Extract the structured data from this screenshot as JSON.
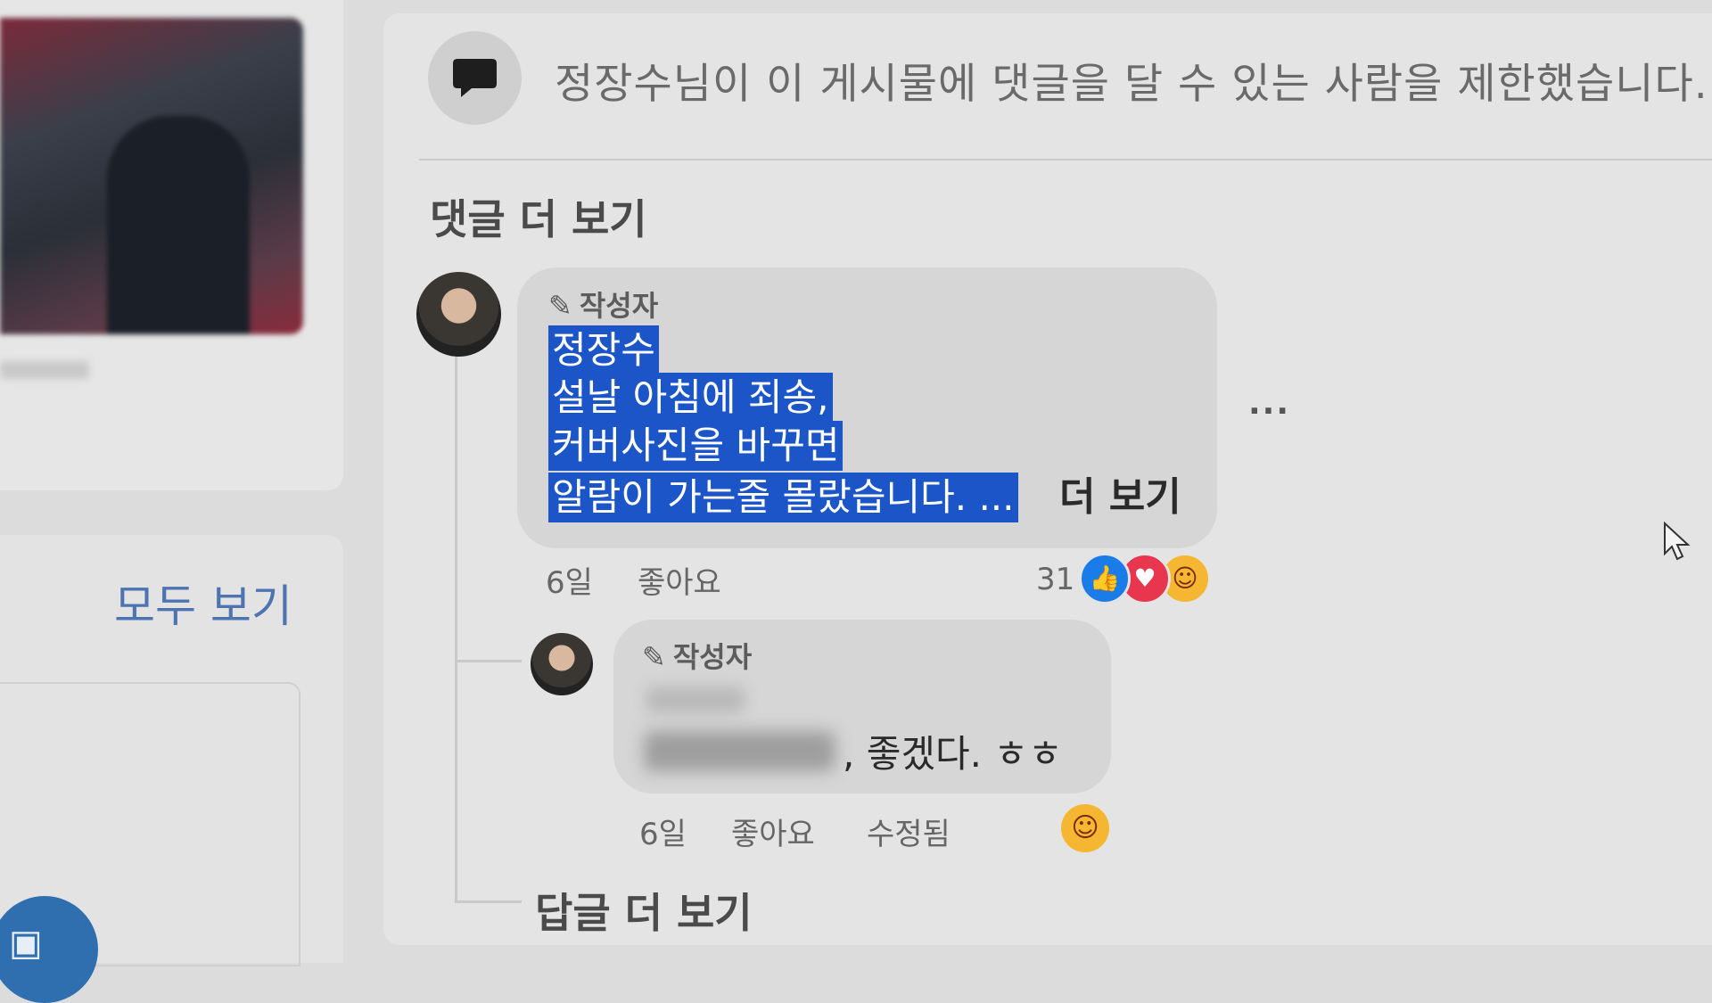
{
  "sidebar": {
    "see_all": "모두 보기"
  },
  "notice": {
    "text": "정장수님이 이 게시물에 댓글을 달 수 있는 사람을 제한했습니다."
  },
  "comments_section": {
    "more_comments": "댓글 더 보기",
    "more_replies": "답글 더 보기"
  },
  "comment": {
    "author_badge": "작성자",
    "lines": [
      "정장수",
      "설날 아침에 죄송,",
      "커버사진을 바꾸면",
      "알람이 가는줄 몰랐습니다. ..."
    ],
    "see_more": "더 보기",
    "more_options": "...",
    "time": "6일",
    "like": "좋아요",
    "reaction_count": "31",
    "reactions": [
      "like-icon",
      "love-icon",
      "haha-icon"
    ]
  },
  "reply": {
    "author_badge": "작성자",
    "text": ", 좋겠다. ㅎㅎ",
    "time": "6일",
    "like": "좋아요",
    "edited": "수정됨",
    "reactions": [
      "haha-icon"
    ]
  },
  "colors": {
    "highlight": "#1b55c8",
    "link_blue": "#4d74b0",
    "like_blue": "#1a7ce8",
    "love_red": "#e8364f",
    "haha_yellow": "#f5b731"
  }
}
